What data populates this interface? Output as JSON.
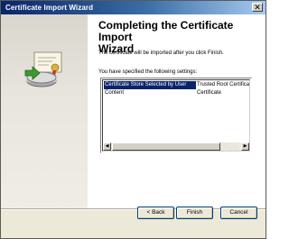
{
  "window": {
    "title": "Certificate Import Wizard"
  },
  "titlebar": {
    "close_glyph": "✕"
  },
  "page": {
    "heading_line1": "Completing the Certificate Import",
    "heading_line2": "Wizard",
    "description": "The certificate will be imported after you click Finish.",
    "settings_label": "You have specified the following settings:"
  },
  "settings": {
    "rows": [
      {
        "name": "Certificate Store Selected by User",
        "value": "Trusted Root Certifica",
        "selected": true
      },
      {
        "name": "Content",
        "value": "Certificate",
        "selected": false
      }
    ]
  },
  "scrollbar": {
    "left_glyph": "◀",
    "right_glyph": "▶"
  },
  "buttons": {
    "back": "< Back",
    "finish": "Finish",
    "cancel": "Cancel"
  },
  "icons": {
    "wizard_art": "certificate-import-icon",
    "close": "close-icon"
  },
  "colors": {
    "titlebar_start": "#0a246a",
    "titlebar_end": "#a6caf0",
    "selection": "#0a246a",
    "dialog_bg": "#ece9d8"
  }
}
